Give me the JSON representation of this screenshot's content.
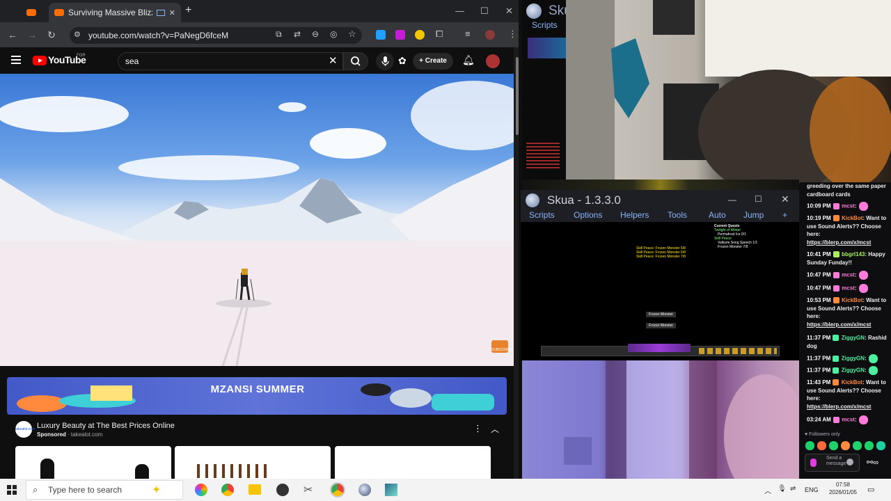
{
  "browser": {
    "tabs": [
      {
        "title": ""
      },
      {
        "title": "Surviving Massive Blizzard"
      }
    ],
    "new_tab": "+",
    "url": "youtube.com/watch?v=PaNegD6fceM"
  },
  "youtube": {
    "logo": "YouTube",
    "logo_sup": "FOR",
    "search_value": "sea",
    "clear": "✕",
    "create": "Create",
    "subscribe_watermark": "SUBSCRIBE",
    "ad": {
      "banner_text": "MZANSI SUMMER",
      "logo_text": "takealot.com",
      "title": "Luxury Beauty at The Best Prices Online",
      "sponsored": "Sponsored",
      "domain": "takealot.com"
    }
  },
  "skua_back": {
    "title": "Sku",
    "menu": "Scripts"
  },
  "skua": {
    "title": "Skua - 1.3.3.0",
    "menu": [
      "Scripts",
      "Options",
      "Helpers",
      "Tools",
      "Auto",
      "Jump",
      "+"
    ],
    "quests_header": "Current Quests",
    "quest_lines": [
      "Twilight of Winter",
      "Permafrost Ice 0/1",
      "Skill Peace",
      "Valkyrie Song Speech 1/1",
      "Frozen Monster 7/8"
    ],
    "pa_lines": [
      "Skill Peace: Frozen Monster 5/8",
      "Skill Peace: Frozen Monster 6/8",
      "Skill Peace: Frozen Monster 7/8"
    ],
    "monsters": [
      "Frozen Monster",
      "Frozen Monster"
    ]
  },
  "chat": {
    "top_text": "greeding over the same paper cardboard cards",
    "messages": [
      {
        "time": "10:09 PM",
        "user": "mcst",
        "color": "#ff7ad9",
        "text": ""
      },
      {
        "time": "10:19 PM",
        "user": "KickBot",
        "color": "#ff8a3d",
        "text": "Want to use Sound Alerts?? Choose here:",
        "link": "https://blerp.com/x/mcst"
      },
      {
        "time": "10:41 PM",
        "user": "bbgrl143",
        "color": "#a8f05c",
        "text": "Happy Sunday Funday!!"
      },
      {
        "time": "10:47 PM",
        "user": "mcst",
        "color": "#ff7ad9",
        "text": ""
      },
      {
        "time": "10:47 PM",
        "user": "mcst",
        "color": "#ff7ad9",
        "text": ""
      },
      {
        "time": "10:53 PM",
        "user": "KickBot",
        "color": "#ff8a3d",
        "text": "Want to use Sound Alerts?? Choose here:",
        "link": "https://blerp.com/x/mcst"
      },
      {
        "time": "11:37 PM",
        "user": "ZiggyGN",
        "color": "#4df0a0",
        "text": "Rashid dog"
      },
      {
        "time": "11:37 PM",
        "user": "ZiggyGN",
        "color": "#4df0a0",
        "text": ""
      },
      {
        "time": "11:37 PM",
        "user": "ZiggyGN",
        "color": "#4df0a0",
        "text": ""
      },
      {
        "time": "11:43 PM",
        "user": "KickBot",
        "color": "#ff8a3d",
        "text": "Want to use Sound Alerts?? Choose here:",
        "link": "https://blerp.com/x/mcst"
      },
      {
        "time": "03:24 AM",
        "user": "mcst",
        "color": "#ff7ad9",
        "text": ""
      }
    ],
    "followers_only": "Followers only",
    "input_placeholder": "Send a message"
  },
  "taskbar": {
    "search_placeholder": "Type here to search",
    "lang": "ENG",
    "time": "07:58",
    "date": "2026/01/05"
  }
}
